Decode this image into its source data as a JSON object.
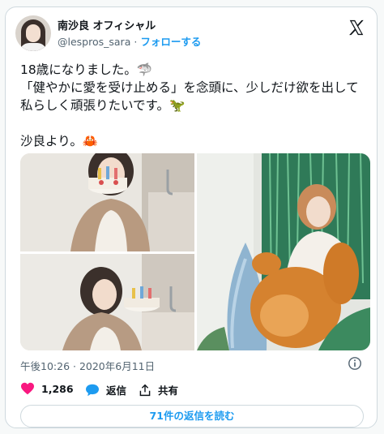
{
  "author": {
    "name": "南沙良 オフィシャル",
    "handle": "@lespros_sara",
    "separator": "·",
    "follow_label": "フォローする"
  },
  "tweet": {
    "text": "18歳になりました。🦈\n「健やかに愛を受け止める」を念頭に、少しだけ欲を出して私らしく頑張りたいです。🦖\n\n沙良より。🦀",
    "timestamp": "午後10:26 · 2020年6月11日"
  },
  "actions": {
    "like_count": "1,286",
    "reply_label": "返信",
    "share_label": "共有"
  },
  "replies_button": "71件の返信を読む",
  "colors": {
    "accent": "#1d9bf0",
    "like": "#f91880",
    "text": "#0f1419",
    "muted": "#536471",
    "border": "#cfd9de"
  },
  "icons": [
    "x-logo-icon",
    "info-icon",
    "heart-icon",
    "speech-bubble-icon",
    "share-icon"
  ]
}
